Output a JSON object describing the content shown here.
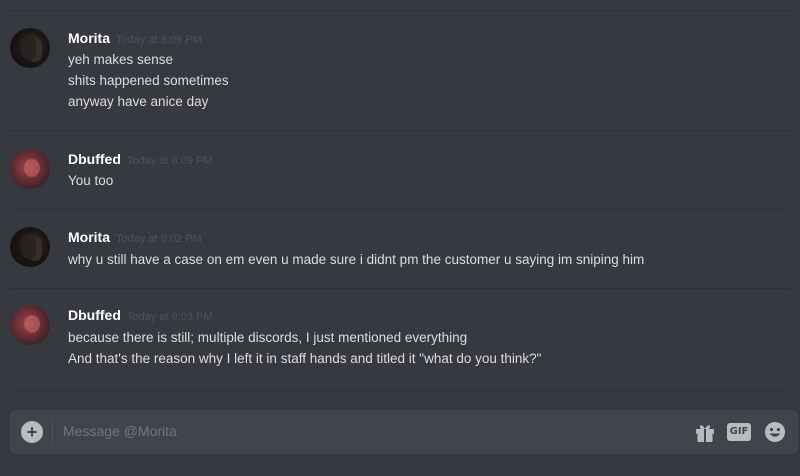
{
  "messages": [
    {
      "author": "Morita",
      "timestamp": "Today at 8:09 PM",
      "avatar": "morita-avatar",
      "lines": [
        "yeh makes sense",
        "shits happened sometimes",
        "anyway have anice day"
      ]
    },
    {
      "author": "Dbuffed",
      "timestamp": "Today at 8:09 PM",
      "avatar": "dbuffed-avatar",
      "lines": [
        "You too"
      ]
    },
    {
      "author": "Morita",
      "timestamp": "Today at 9:02 PM",
      "avatar": "morita-avatar",
      "lines": [
        "why u still have a case on em even u made sure i didnt pm the customer u saying im sniping him"
      ]
    },
    {
      "author": "Dbuffed",
      "timestamp": "Today at 9:03 PM",
      "avatar": "dbuffed-avatar",
      "lines": [
        "because there is still; multiple discords, I just mentioned everything",
        "And that's the reason why I left it in staff hands and titled it \"what do you think?\""
      ]
    }
  ],
  "composer": {
    "placeholder": "Message @Morita",
    "plus_icon": "plus-circle-icon",
    "gift_icon": "gift-icon",
    "gif_label": "GIF",
    "emoji_icon": "emoji-icon"
  },
  "colors": {
    "background": "#36393f",
    "input_background": "#40444b",
    "username": "#ffffff",
    "message_text": "#dcddde",
    "timestamp": "#4f5257",
    "icon": "#b9bbbe"
  }
}
